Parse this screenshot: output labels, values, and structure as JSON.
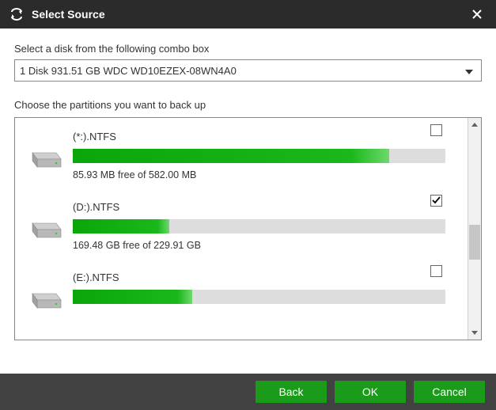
{
  "dialog": {
    "title": "Select Source"
  },
  "labels": {
    "disk_prompt": "Select a disk from the following combo box",
    "partition_prompt": "Choose the partitions you want to back up"
  },
  "combo": {
    "selected": "1 Disk 931.51 GB WDC WD10EZEX-08WN4A0"
  },
  "partitions": [
    {
      "name": "(*:).NTFS",
      "free_text": "85.93 MB free of 582.00 MB",
      "used_pct": 85,
      "checked": false
    },
    {
      "name": "(D:).NTFS",
      "free_text": "169.48 GB free of 229.91 GB",
      "used_pct": 26,
      "checked": true
    },
    {
      "name": "(E:).NTFS",
      "free_text": "",
      "used_pct": 32,
      "checked": false
    }
  ],
  "buttons": {
    "back": "Back",
    "ok": "OK",
    "cancel": "Cancel"
  },
  "scrollbar": {
    "thumb_top_pct": 48,
    "thumb_height_pct": 18
  }
}
